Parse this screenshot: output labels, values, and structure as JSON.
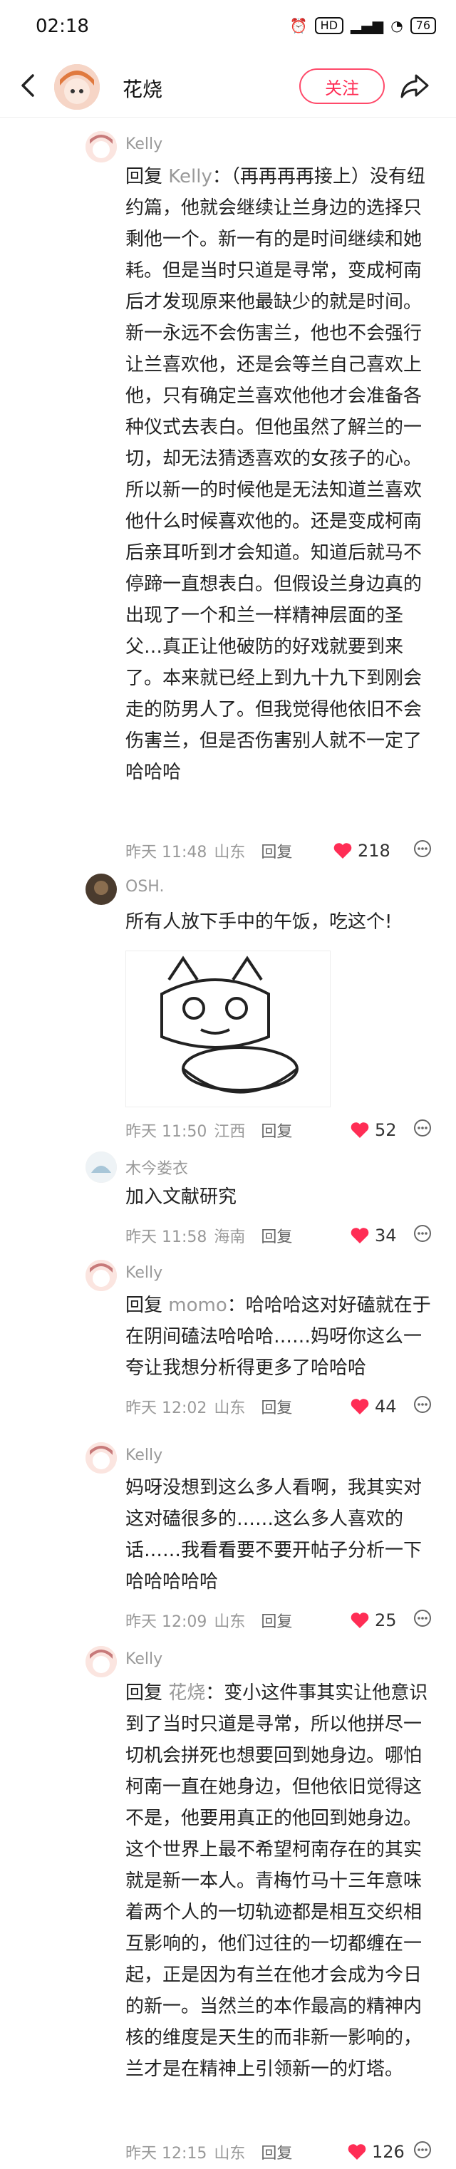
{
  "status": {
    "time": "02:18",
    "network": "HD",
    "battery": "76"
  },
  "header": {
    "author": "花烧",
    "follow_label": "关注"
  },
  "comments": [
    {
      "user": "Kelly",
      "reply_prefix": "回复",
      "reply_to": "Kelly",
      "text": "：（再再再再接上）没有纽约篇，他就会继续让兰身边的选择只剩他一个。新一有的是时间继续和她耗。但是当时只道是寻常，变成柯南后才发现原来他最缺少的就是时间。新一永远不会伤害兰，他也不会强行让兰喜欢他，还是会等兰自己喜欢上他，只有确定兰喜欢他他才会准备各种仪式去表白。但他虽然了解兰的一切，却无法猜透喜欢的女孩子的心。所以新一的时候他是无法知道兰喜欢他什么时候喜欢他的。还是变成柯南后亲耳听到才会知道。知道后就马不停蹄一直想表白。但假设兰身边真的出现了一个和兰一样精神层面的圣父…真正让他破防的好戏就要到来了。本来就已经上到九十九下到刚会走的防男人了。但我觉得他依旧不会伤害兰，但是否伤害别人就不一定了哈哈哈",
      "time": "昨天 11:48",
      "location": "山东",
      "reply_label": "回复",
      "likes": "218"
    },
    {
      "user": "OSH.",
      "text": "所有人放下手中的午饭，吃这个!",
      "time": "昨天 11:50",
      "location": "江西",
      "reply_label": "回复",
      "likes": "52"
    },
    {
      "user": "木今娄衣",
      "text": "加入文献研究",
      "time": "昨天 11:58",
      "location": "海南",
      "reply_label": "回复",
      "likes": "34"
    },
    {
      "user": "Kelly",
      "reply_prefix": "回复",
      "reply_to": "momo",
      "text": "：哈哈哈这对好磕就在于在阴间磕法哈哈哈……妈呀你这么一夸让我想分析得更多了哈哈哈",
      "time": "昨天 12:02",
      "location": "山东",
      "reply_label": "回复",
      "likes": "44"
    },
    {
      "user": "Kelly",
      "text": "妈呀没想到这么多人看啊，我其实对这对磕很多的……这么多人喜欢的话……我看看要不要开帖子分析一下哈哈哈哈哈",
      "time": "昨天 12:09",
      "location": "山东",
      "reply_label": "回复",
      "likes": "25"
    },
    {
      "user": "Kelly",
      "reply_prefix": "回复",
      "reply_to": "花烧",
      "text": "：变小这件事其实让他意识到了当时只道是寻常，所以他拼尽一切机会拼死也想要回到她身边。哪怕柯南一直在她身边，但他依旧觉得这不是，他要用真正的他回到她身边。这个世界上最不希望柯南存在的其实就是新一本人。青梅竹马十三年意味着两个人的一切轨迹都是相互交织相互影响的，他们过往的一切都缠在一起，正是因为有兰在他才会成为今日的新一。当然兰的本作最高的精神内核的维度是天生的而非新一影响的，兰才是在精神上引领新一的灯塔。",
      "time": "昨天 12:15",
      "location": "山东",
      "reply_label": "回复",
      "likes": "126"
    }
  ]
}
